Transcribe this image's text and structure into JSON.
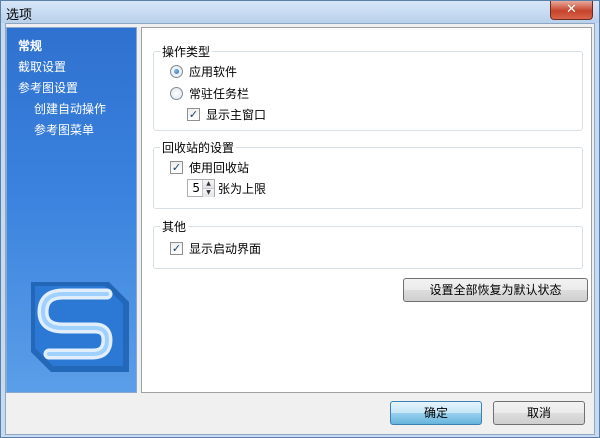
{
  "window": {
    "title": "选项",
    "close_label": "✕"
  },
  "sidebar": {
    "items": [
      {
        "label": "常规"
      },
      {
        "label": "截取设置"
      },
      {
        "label": "参考图设置"
      },
      {
        "label": "创建自动操作"
      },
      {
        "label": "参考图菜单"
      }
    ]
  },
  "groups": {
    "operation": {
      "title": "操作类型",
      "options": [
        {
          "label": "应用软件",
          "selected": true
        },
        {
          "label": "常驻任务栏",
          "selected": false
        }
      ],
      "show_main_window": {
        "label": "显示主窗口",
        "checked": true
      }
    },
    "recycle": {
      "title": "回收站的设置",
      "use_recycle": {
        "label": "使用回收站",
        "checked": true
      },
      "limit": {
        "value": "5",
        "suffix": "张为上限"
      }
    },
    "other": {
      "title": "其他",
      "show_splash": {
        "label": "显示启动界面",
        "checked": true
      }
    }
  },
  "buttons": {
    "reset": "设置全部恢复为默认状态",
    "ok": "确定",
    "cancel": "取消"
  },
  "glyphs": {
    "check": "✓",
    "spin_up": "▲",
    "spin_down": "▼"
  },
  "colors": {
    "sidebar_top": "#2f71cf",
    "sidebar_bottom": "#5b9ee8",
    "primary_button": "#98d1ef"
  }
}
